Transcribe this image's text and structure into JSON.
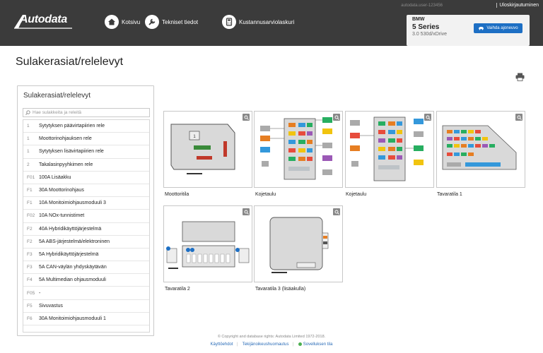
{
  "header": {
    "brand": "Autodata",
    "nav": [
      {
        "label": "Kotsivu",
        "icon": "home-icon"
      },
      {
        "label": "Tekniset tiedot",
        "icon": "wrench-icon"
      },
      {
        "label": "Kustannusarviolaskuri",
        "icon": "calculator-icon"
      }
    ],
    "user": "autodata.user-123456",
    "logout": "Uloskirjautuminen"
  },
  "vehicle": {
    "make": "BMW",
    "model": "5 Series",
    "variant": "3.0 530d/xDrive",
    "change_button": "Vaihda ajoneuvo"
  },
  "page": {
    "title": "Sulakerasiat/relelevyt"
  },
  "sidebar": {
    "title": "Sulakerasiat/relelevyt",
    "search_placeholder": "Hae sulakkeita ja releitä",
    "items": [
      {
        "num": "1",
        "label": "Sytytyksen päävirtapiirien rele"
      },
      {
        "num": "1",
        "label": "Moottorinohjauksen rele"
      },
      {
        "num": "1",
        "label": "Sytytyksen lisävirtapiirien rele"
      },
      {
        "num": "2",
        "label": "Takalasinpyyhkimen rele"
      },
      {
        "num": "F01",
        "label": "100A Lisäakku"
      },
      {
        "num": "F1",
        "label": "30A Moottorinohjaus"
      },
      {
        "num": "F1",
        "label": "10A Monitoimiohjausmoduuli 3"
      },
      {
        "num": "F02",
        "label": "10A NOx-tunnistimet"
      },
      {
        "num": "F2",
        "label": "40A Hybridikäyttöjärjestelmä"
      },
      {
        "num": "F2",
        "label": "5A ABS-järjestelmä/elektroninen"
      },
      {
        "num": "F3",
        "label": "5A Hybridikäyttöjärjestelmä"
      },
      {
        "num": "F3",
        "label": "5A CAN-väylän yhdyskäytävän"
      },
      {
        "num": "F4",
        "label": "5A Multimedian ohjausmoduuli"
      },
      {
        "num": "F05",
        "label": "-"
      },
      {
        "num": "F5",
        "label": "Sivuvastus"
      },
      {
        "num": "F6",
        "label": "30A Monitoimiohjausmoduuli 1"
      }
    ]
  },
  "diagrams": [
    {
      "label": "Moottoritila"
    },
    {
      "label": "Kojetaulu"
    },
    {
      "label": "Kojetaulu"
    },
    {
      "label": "Tavaratila 1"
    },
    {
      "label": "Tavaratila 2"
    },
    {
      "label": "Tavaratila 3 (lisäakulla)"
    }
  ],
  "footer": {
    "copyright": "© Copyright and database rights: Autodata Limited 1972-2018.",
    "terms": "Käyttöehdot",
    "privacy": "Tekijänoikeushuomautus",
    "status": "Sovelluksen tila"
  },
  "colors": {
    "header_bg": "#3b3b3b",
    "accent": "#1d6fc4"
  }
}
